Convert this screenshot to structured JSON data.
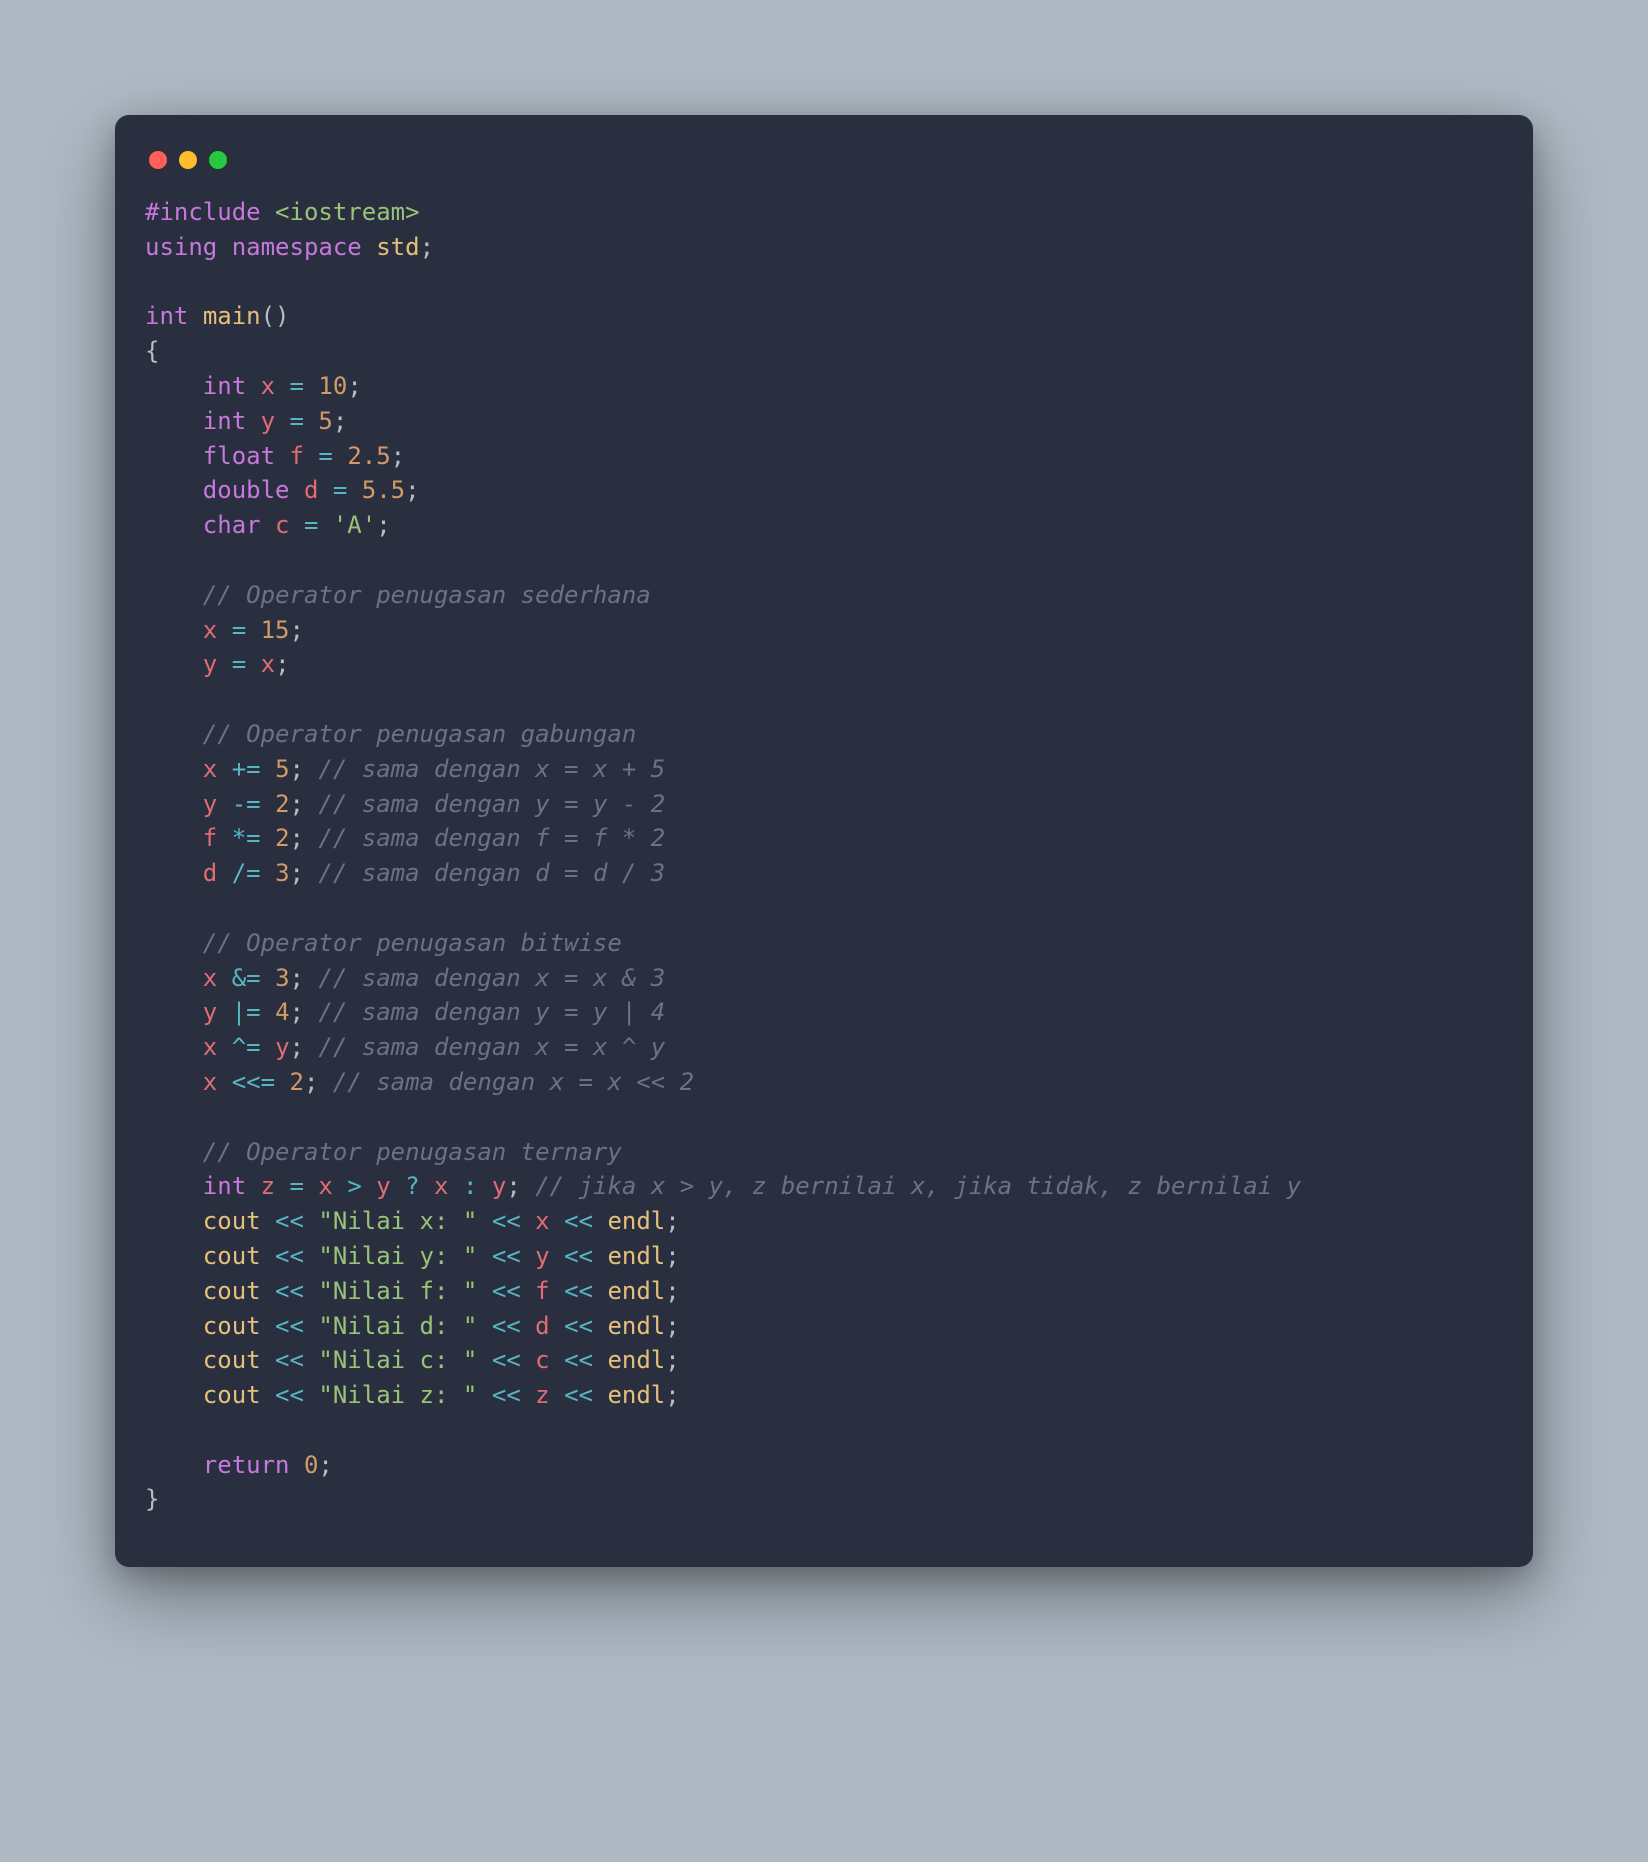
{
  "window": {
    "buttons": [
      "close",
      "minimize",
      "zoom"
    ]
  },
  "code": {
    "tokens": [
      [
        [
          "pre",
          "#include"
        ],
        [
          "punc",
          " "
        ],
        [
          "hdr",
          "<iostream>"
        ]
      ],
      [
        [
          "kw",
          "using"
        ],
        [
          "punc",
          " "
        ],
        [
          "kw",
          "namespace"
        ],
        [
          "punc",
          " "
        ],
        [
          "ident",
          "std"
        ],
        [
          "punc",
          ";"
        ]
      ],
      [],
      [
        [
          "type",
          "int"
        ],
        [
          "punc",
          " "
        ],
        [
          "fn",
          "main"
        ],
        [
          "punc",
          "()"
        ]
      ],
      [
        [
          "punc",
          "{"
        ]
      ],
      [
        [
          "punc",
          "    "
        ],
        [
          "type",
          "int"
        ],
        [
          "punc",
          " "
        ],
        [
          "var",
          "x"
        ],
        [
          "punc",
          " "
        ],
        [
          "op",
          "="
        ],
        [
          "punc",
          " "
        ],
        [
          "num",
          "10"
        ],
        [
          "punc",
          ";"
        ]
      ],
      [
        [
          "punc",
          "    "
        ],
        [
          "type",
          "int"
        ],
        [
          "punc",
          " "
        ],
        [
          "var",
          "y"
        ],
        [
          "punc",
          " "
        ],
        [
          "op",
          "="
        ],
        [
          "punc",
          " "
        ],
        [
          "num",
          "5"
        ],
        [
          "punc",
          ";"
        ]
      ],
      [
        [
          "punc",
          "    "
        ],
        [
          "type",
          "float"
        ],
        [
          "punc",
          " "
        ],
        [
          "var",
          "f"
        ],
        [
          "punc",
          " "
        ],
        [
          "op",
          "="
        ],
        [
          "punc",
          " "
        ],
        [
          "num",
          "2.5"
        ],
        [
          "punc",
          ";"
        ]
      ],
      [
        [
          "punc",
          "    "
        ],
        [
          "type",
          "double"
        ],
        [
          "punc",
          " "
        ],
        [
          "var",
          "d"
        ],
        [
          "punc",
          " "
        ],
        [
          "op",
          "="
        ],
        [
          "punc",
          " "
        ],
        [
          "num",
          "5.5"
        ],
        [
          "punc",
          ";"
        ]
      ],
      [
        [
          "punc",
          "    "
        ],
        [
          "type",
          "char"
        ],
        [
          "punc",
          " "
        ],
        [
          "var",
          "c"
        ],
        [
          "punc",
          " "
        ],
        [
          "op",
          "="
        ],
        [
          "punc",
          " "
        ],
        [
          "hdr",
          "'A'"
        ],
        [
          "punc",
          ";"
        ]
      ],
      [],
      [
        [
          "punc",
          "    "
        ],
        [
          "cmt",
          "// Operator penugasan sederhana"
        ]
      ],
      [
        [
          "punc",
          "    "
        ],
        [
          "var",
          "x"
        ],
        [
          "punc",
          " "
        ],
        [
          "op",
          "="
        ],
        [
          "punc",
          " "
        ],
        [
          "num",
          "15"
        ],
        [
          "punc",
          ";"
        ]
      ],
      [
        [
          "punc",
          "    "
        ],
        [
          "var",
          "y"
        ],
        [
          "punc",
          " "
        ],
        [
          "op",
          "="
        ],
        [
          "punc",
          " "
        ],
        [
          "var",
          "x"
        ],
        [
          "punc",
          ";"
        ]
      ],
      [],
      [
        [
          "punc",
          "    "
        ],
        [
          "cmt",
          "// Operator penugasan gabungan"
        ]
      ],
      [
        [
          "punc",
          "    "
        ],
        [
          "var",
          "x"
        ],
        [
          "punc",
          " "
        ],
        [
          "op",
          "+="
        ],
        [
          "punc",
          " "
        ],
        [
          "num",
          "5"
        ],
        [
          "punc",
          "; "
        ],
        [
          "cmt",
          "// sama dengan x = x + 5"
        ]
      ],
      [
        [
          "punc",
          "    "
        ],
        [
          "var",
          "y"
        ],
        [
          "punc",
          " "
        ],
        [
          "op",
          "-="
        ],
        [
          "punc",
          " "
        ],
        [
          "num",
          "2"
        ],
        [
          "punc",
          "; "
        ],
        [
          "cmt",
          "// sama dengan y = y - 2"
        ]
      ],
      [
        [
          "punc",
          "    "
        ],
        [
          "var",
          "f"
        ],
        [
          "punc",
          " "
        ],
        [
          "op",
          "*="
        ],
        [
          "punc",
          " "
        ],
        [
          "num",
          "2"
        ],
        [
          "punc",
          "; "
        ],
        [
          "cmt",
          "// sama dengan f = f * 2"
        ]
      ],
      [
        [
          "punc",
          "    "
        ],
        [
          "var",
          "d"
        ],
        [
          "punc",
          " "
        ],
        [
          "op",
          "/="
        ],
        [
          "punc",
          " "
        ],
        [
          "num",
          "3"
        ],
        [
          "punc",
          "; "
        ],
        [
          "cmt",
          "// sama dengan d = d / 3"
        ]
      ],
      [],
      [
        [
          "punc",
          "    "
        ],
        [
          "cmt",
          "// Operator penugasan bitwise"
        ]
      ],
      [
        [
          "punc",
          "    "
        ],
        [
          "var",
          "x"
        ],
        [
          "punc",
          " "
        ],
        [
          "op",
          "&="
        ],
        [
          "punc",
          " "
        ],
        [
          "num",
          "3"
        ],
        [
          "punc",
          "; "
        ],
        [
          "cmt",
          "// sama dengan x = x & 3"
        ]
      ],
      [
        [
          "punc",
          "    "
        ],
        [
          "var",
          "y"
        ],
        [
          "punc",
          " "
        ],
        [
          "op",
          "|="
        ],
        [
          "punc",
          " "
        ],
        [
          "num",
          "4"
        ],
        [
          "punc",
          "; "
        ],
        [
          "cmt",
          "// sama dengan y = y | 4"
        ]
      ],
      [
        [
          "punc",
          "    "
        ],
        [
          "var",
          "x"
        ],
        [
          "punc",
          " "
        ],
        [
          "op",
          "^="
        ],
        [
          "punc",
          " "
        ],
        [
          "var",
          "y"
        ],
        [
          "punc",
          "; "
        ],
        [
          "cmt",
          "// sama dengan x = x ^ y"
        ]
      ],
      [
        [
          "punc",
          "    "
        ],
        [
          "var",
          "x"
        ],
        [
          "punc",
          " "
        ],
        [
          "op",
          "<<="
        ],
        [
          "punc",
          " "
        ],
        [
          "num",
          "2"
        ],
        [
          "punc",
          "; "
        ],
        [
          "cmt",
          "// sama dengan x = x << 2"
        ]
      ],
      [],
      [
        [
          "punc",
          "    "
        ],
        [
          "cmt",
          "// Operator penugasan ternary"
        ]
      ],
      [
        [
          "punc",
          "    "
        ],
        [
          "type",
          "int"
        ],
        [
          "punc",
          " "
        ],
        [
          "var",
          "z"
        ],
        [
          "punc",
          " "
        ],
        [
          "op",
          "="
        ],
        [
          "punc",
          " "
        ],
        [
          "var",
          "x"
        ],
        [
          "punc",
          " "
        ],
        [
          "op",
          ">"
        ],
        [
          "punc",
          " "
        ],
        [
          "var",
          "y"
        ],
        [
          "punc",
          " "
        ],
        [
          "op",
          "?"
        ],
        [
          "punc",
          " "
        ],
        [
          "var",
          "x"
        ],
        [
          "punc",
          " "
        ],
        [
          "op",
          ":"
        ],
        [
          "punc",
          " "
        ],
        [
          "var",
          "y"
        ],
        [
          "punc",
          "; "
        ],
        [
          "cmt",
          "// jika x > y, z bernilai x, jika tidak, z bernilai y"
        ]
      ],
      [
        [
          "punc",
          "    "
        ],
        [
          "ident",
          "cout"
        ],
        [
          "punc",
          " "
        ],
        [
          "op",
          "<<"
        ],
        [
          "punc",
          " "
        ],
        [
          "hdr",
          "\"Nilai x: \""
        ],
        [
          "punc",
          " "
        ],
        [
          "op",
          "<<"
        ],
        [
          "punc",
          " "
        ],
        [
          "var",
          "x"
        ],
        [
          "punc",
          " "
        ],
        [
          "op",
          "<<"
        ],
        [
          "punc",
          " "
        ],
        [
          "ident",
          "endl"
        ],
        [
          "punc",
          ";"
        ]
      ],
      [
        [
          "punc",
          "    "
        ],
        [
          "ident",
          "cout"
        ],
        [
          "punc",
          " "
        ],
        [
          "op",
          "<<"
        ],
        [
          "punc",
          " "
        ],
        [
          "hdr",
          "\"Nilai y: \""
        ],
        [
          "punc",
          " "
        ],
        [
          "op",
          "<<"
        ],
        [
          "punc",
          " "
        ],
        [
          "var",
          "y"
        ],
        [
          "punc",
          " "
        ],
        [
          "op",
          "<<"
        ],
        [
          "punc",
          " "
        ],
        [
          "ident",
          "endl"
        ],
        [
          "punc",
          ";"
        ]
      ],
      [
        [
          "punc",
          "    "
        ],
        [
          "ident",
          "cout"
        ],
        [
          "punc",
          " "
        ],
        [
          "op",
          "<<"
        ],
        [
          "punc",
          " "
        ],
        [
          "hdr",
          "\"Nilai f: \""
        ],
        [
          "punc",
          " "
        ],
        [
          "op",
          "<<"
        ],
        [
          "punc",
          " "
        ],
        [
          "var",
          "f"
        ],
        [
          "punc",
          " "
        ],
        [
          "op",
          "<<"
        ],
        [
          "punc",
          " "
        ],
        [
          "ident",
          "endl"
        ],
        [
          "punc",
          ";"
        ]
      ],
      [
        [
          "punc",
          "    "
        ],
        [
          "ident",
          "cout"
        ],
        [
          "punc",
          " "
        ],
        [
          "op",
          "<<"
        ],
        [
          "punc",
          " "
        ],
        [
          "hdr",
          "\"Nilai d: \""
        ],
        [
          "punc",
          " "
        ],
        [
          "op",
          "<<"
        ],
        [
          "punc",
          " "
        ],
        [
          "var",
          "d"
        ],
        [
          "punc",
          " "
        ],
        [
          "op",
          "<<"
        ],
        [
          "punc",
          " "
        ],
        [
          "ident",
          "endl"
        ],
        [
          "punc",
          ";"
        ]
      ],
      [
        [
          "punc",
          "    "
        ],
        [
          "ident",
          "cout"
        ],
        [
          "punc",
          " "
        ],
        [
          "op",
          "<<"
        ],
        [
          "punc",
          " "
        ],
        [
          "hdr",
          "\"Nilai c: \""
        ],
        [
          "punc",
          " "
        ],
        [
          "op",
          "<<"
        ],
        [
          "punc",
          " "
        ],
        [
          "var",
          "c"
        ],
        [
          "punc",
          " "
        ],
        [
          "op",
          "<<"
        ],
        [
          "punc",
          " "
        ],
        [
          "ident",
          "endl"
        ],
        [
          "punc",
          ";"
        ]
      ],
      [
        [
          "punc",
          "    "
        ],
        [
          "ident",
          "cout"
        ],
        [
          "punc",
          " "
        ],
        [
          "op",
          "<<"
        ],
        [
          "punc",
          " "
        ],
        [
          "hdr",
          "\"Nilai z: \""
        ],
        [
          "punc",
          " "
        ],
        [
          "op",
          "<<"
        ],
        [
          "punc",
          " "
        ],
        [
          "var",
          "z"
        ],
        [
          "punc",
          " "
        ],
        [
          "op",
          "<<"
        ],
        [
          "punc",
          " "
        ],
        [
          "ident",
          "endl"
        ],
        [
          "punc",
          ";"
        ]
      ],
      [],
      [
        [
          "punc",
          "    "
        ],
        [
          "kw",
          "return"
        ],
        [
          "punc",
          " "
        ],
        [
          "num",
          "0"
        ],
        [
          "punc",
          ";"
        ]
      ],
      [
        [
          "punc",
          "}"
        ]
      ]
    ]
  }
}
